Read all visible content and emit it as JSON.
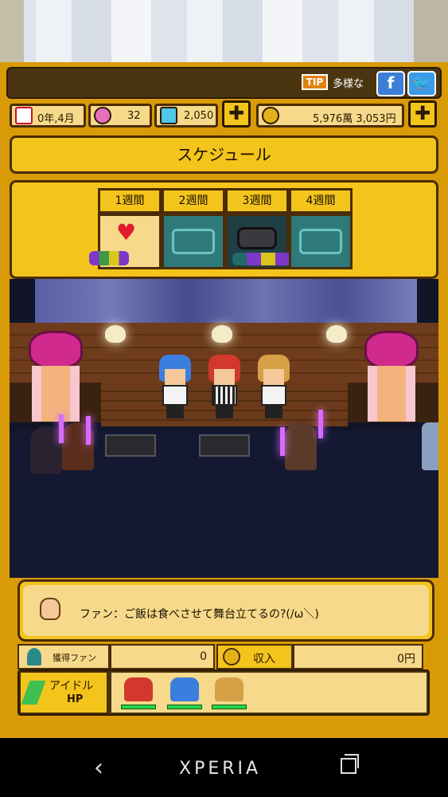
{
  "topbar": {
    "tip_badge": "TIP",
    "tip_text": "多様な",
    "facebook_label": "f",
    "twitter_label": "🐦"
  },
  "status": {
    "date": "0年,4月",
    "gems": "32",
    "diamonds": "2,050",
    "money": "5,976萬 3,053円",
    "plus": "✚"
  },
  "schedule": {
    "title": "スケジュール",
    "weeks": [
      "1週間",
      "2週間",
      "3週間",
      "4週間"
    ]
  },
  "dialog": {
    "text": "ファン：ご飯は食べさせて舞台立てるの?(/ω＼)"
  },
  "stats": {
    "fans_label": "獲得ファン",
    "fans_value": "0",
    "income_label": "収入",
    "income_value": "0円",
    "hp_label_line1": "アイドル",
    "hp_label_line2": "HP"
  },
  "colors": {
    "frame": "#d99a07",
    "accent": "#f3c41c",
    "panel_light": "#f6d98a",
    "outline": "#4a2c06",
    "hp_green": "#2bd34a"
  },
  "navbar": {
    "back": "‹",
    "brand": "XPERIA"
  }
}
